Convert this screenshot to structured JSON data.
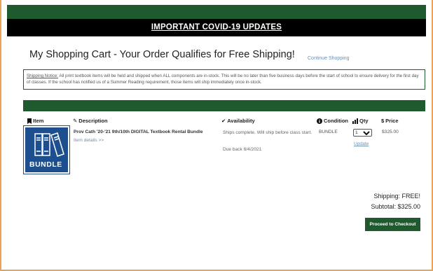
{
  "banner": {
    "covid_updates": "IMPORTANT COVID-19 UPDATES"
  },
  "cart": {
    "title": "My Shopping Cart - Your Order Qualifies for Free Shipping!",
    "continue_link": "Continue Shopping",
    "notice_label": "Shipping Notice:",
    "notice_text": " All print textbook items will be held and shipped when ALL components are in-stock. This will be no later than five business days before the start of school to ensure delivery for the first day of classes. If the school has notified us of a Summer Reading requirement, those items will ship immediately once in-stock."
  },
  "columns": {
    "item": "Item",
    "description": "Description",
    "availability": "Availability",
    "condition": "Condition",
    "qty": "Qty",
    "price": "Price"
  },
  "icons": {
    "item": "bookmark-icon",
    "description": "pencil-icon",
    "availability": "checkmark-icon",
    "condition": "info-icon",
    "qty": "bar-chart-icon",
    "price": "dollar-icon"
  },
  "line_item": {
    "image_label": "BUNDLE",
    "description": "Prov Cath '20-'21 9th/10th DIGITAL Textbook Rental Bundle",
    "details_link": "Item details >>",
    "availability": "Ships complete. Will ship before class start.",
    "due_back": "Due back 6/4/2021",
    "condition": "BUNDLE",
    "qty_selected": "1",
    "update_link": "Update",
    "price": "$325.00"
  },
  "totals": {
    "shipping": "Shipping: FREE!",
    "subtotal": "Subtotal: $325.00",
    "checkout_button": "Proceed to Checkout"
  },
  "colors": {
    "brand_green": "#1f5a2e",
    "banner_black": "#000000",
    "link_blue": "#6d8fb3",
    "bundle_blue": "#1d4f8f",
    "frame_orange": "#e8a35a"
  }
}
